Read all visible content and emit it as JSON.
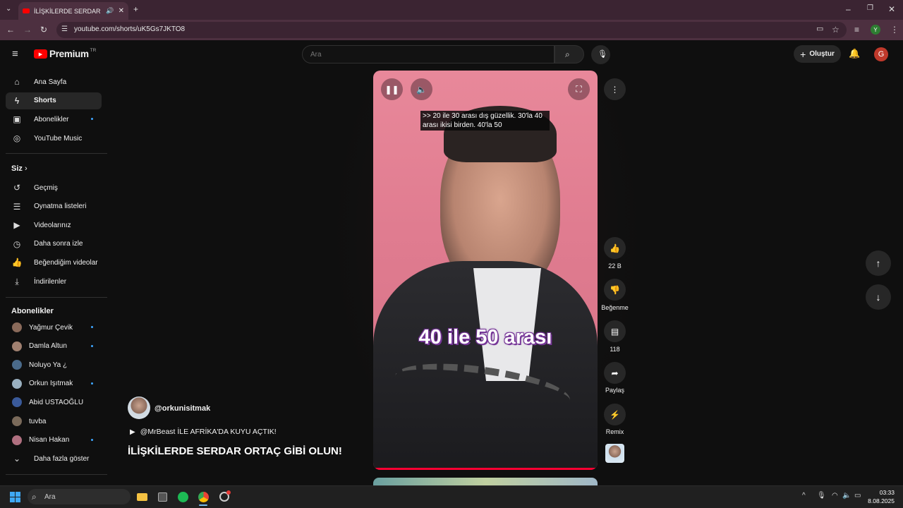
{
  "browser": {
    "tab_title": "İLİŞKİLERDE SERDAR ORTAÇ",
    "url": "youtube.com/shorts/uK5Gs7JKTO8",
    "profile_initial": "Y"
  },
  "header": {
    "logo_text": "Premium",
    "logo_region": "TR",
    "search_placeholder": "Ara",
    "create_label": "Oluştur",
    "avatar_initial": "G"
  },
  "sidebar": {
    "main": [
      {
        "label": "Ana Sayfa",
        "icon": "home-icon"
      },
      {
        "label": "Shorts",
        "icon": "shorts-icon",
        "active": true
      },
      {
        "label": "Abonelikler",
        "icon": "subscriptions-icon",
        "dot": true
      },
      {
        "label": "YouTube Music",
        "icon": "music-icon"
      }
    ],
    "you_heading": "Siz",
    "you": [
      {
        "label": "Geçmiş",
        "icon": "history-icon"
      },
      {
        "label": "Oynatma listeleri",
        "icon": "playlist-icon"
      },
      {
        "label": "Videolarınız",
        "icon": "your-videos-icon"
      },
      {
        "label": "Daha sonra izle",
        "icon": "watch-later-icon"
      },
      {
        "label": "Beğendiğim videolar",
        "icon": "liked-icon"
      },
      {
        "label": "İndirilenler",
        "icon": "download-icon"
      }
    ],
    "subs_heading": "Abonelikler",
    "subs": [
      {
        "label": "Yağmur Çevik",
        "dot": true,
        "color": "#8a6a5a"
      },
      {
        "label": "Damla Altun",
        "dot": true,
        "color": "#a08070"
      },
      {
        "label": "Noluyo Ya ¿",
        "dot": false,
        "color": "#4a6a8a"
      },
      {
        "label": "Orkun Işıtmak",
        "dot": true,
        "color": "#9ab0c0"
      },
      {
        "label": "Abid USTAOĞLU",
        "dot": false,
        "color": "#3a5a9a"
      },
      {
        "label": "tuvba",
        "dot": false,
        "color": "#7a6a5a"
      },
      {
        "label": "Nisan Hakan",
        "dot": true,
        "color": "#b07080"
      }
    ],
    "show_more": "Daha fazla göster"
  },
  "video": {
    "subtitle": ">> 20 ile 30 arası dış güzellik. 30'la 40 arası ikisi birden. 40'la 50",
    "caption": "40 ile 50 arası",
    "progress": 1.0
  },
  "actions": {
    "like_count": "22 B",
    "dislike_label": "Beğenme",
    "comment_count": "118",
    "share_label": "Paylaş",
    "remix_label": "Remix"
  },
  "channel": {
    "handle": "@orkunisitmak",
    "description": "@MrBeast İLE AFRİKA'DA KUYU AÇTIK!",
    "title": "İLİŞKİLERDE SERDAR ORTAÇ GİBİ OLUN!"
  },
  "taskbar": {
    "search_text": "Ara",
    "time": "03:33",
    "date": "8.08.2025"
  },
  "colors": {
    "accent": "#ff0033",
    "link": "#3ea6ff"
  }
}
